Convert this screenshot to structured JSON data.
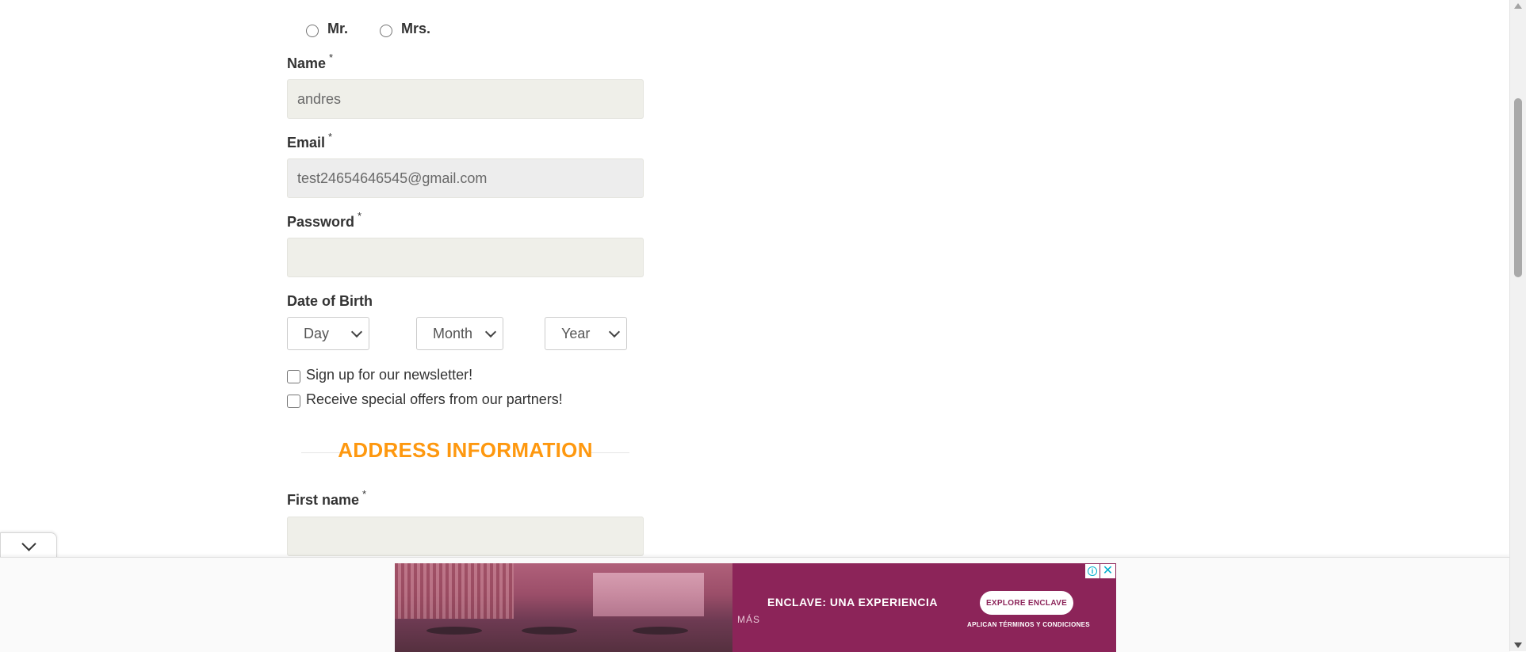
{
  "form": {
    "title_options": [
      "Mr.",
      "Mrs."
    ],
    "name": {
      "label": "Name",
      "required_mark": "*",
      "value": "andres"
    },
    "email": {
      "label": "Email",
      "required_mark": "*",
      "value": "test24654646545@gmail.com"
    },
    "password": {
      "label": "Password",
      "required_mark": "*",
      "value": ""
    },
    "dob": {
      "label": "Date of Birth",
      "day": "Day",
      "month": "Month",
      "year": "Year"
    },
    "newsletter_label": "Sign up for our newsletter!",
    "offers_label": "Receive special offers from our partners!",
    "address_heading": "ADDRESS INFORMATION",
    "first_name": {
      "label": "First name",
      "required_mark": "*",
      "value": ""
    }
  },
  "ad": {
    "headline": "ENCLAVE: UNA EXPERIENCIA",
    "subline": "MÁS",
    "cta": "EXPLORE ENCLAVE",
    "fine_print": "APLICAN TÉRMINOS Y CONDICIONES",
    "info_icon": "i",
    "close_icon": "✕"
  },
  "colors": {
    "accent": "#fe980f",
    "input_bg": "#efefe9",
    "ad_bg": "#8c2459",
    "ad_icon": "#00aecd"
  }
}
